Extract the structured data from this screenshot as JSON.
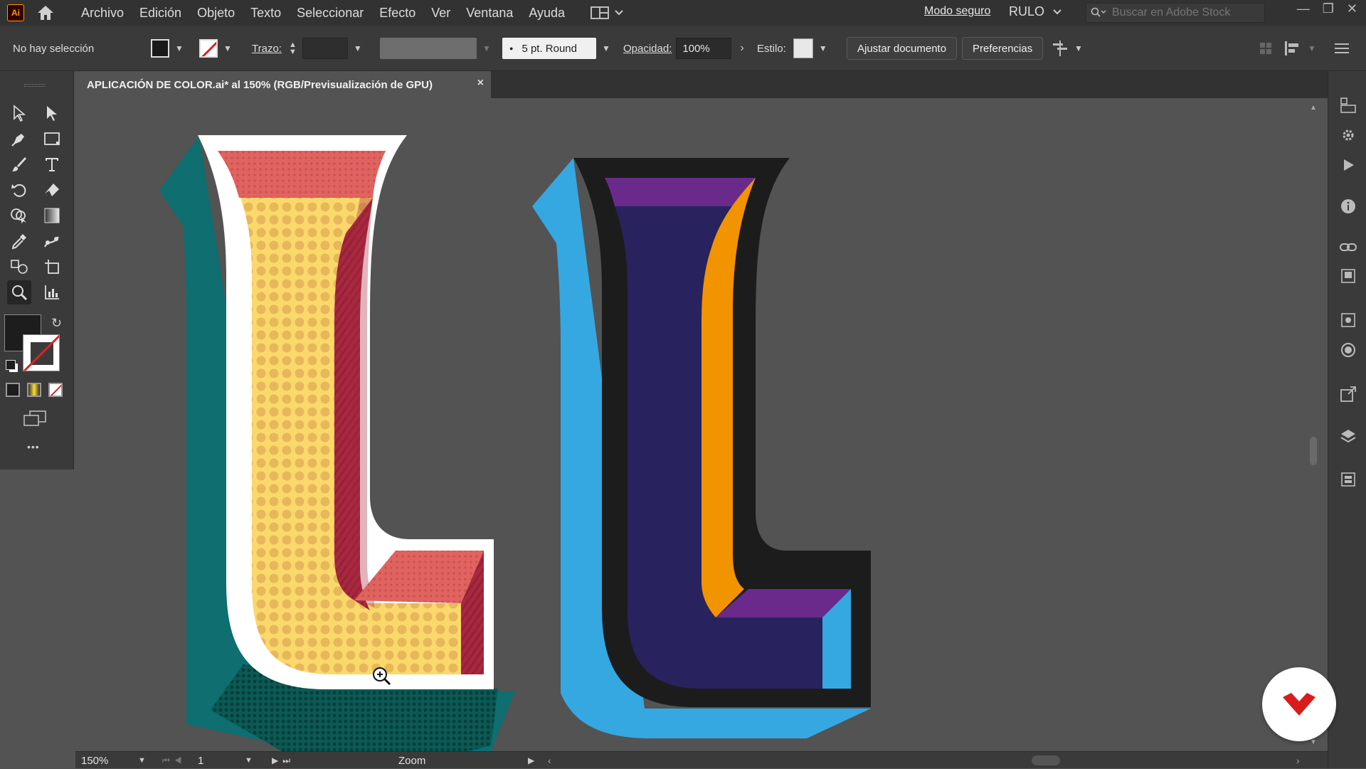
{
  "app": {
    "logo": "Ai",
    "menu": [
      "Archivo",
      "Edición",
      "Objeto",
      "Texto",
      "Seleccionar",
      "Efecto",
      "Ver",
      "Ventana",
      "Ayuda"
    ],
    "mode": "Modo seguro",
    "user": "RULO",
    "search_placeholder": "Buscar en Adobe Stock"
  },
  "control_bar": {
    "selection": "No hay selección",
    "stroke_label": "Trazo:",
    "brush": "5 pt. Round",
    "opacity_label": "Opacidad:",
    "opacity_value": "100%",
    "style_label": "Estilo:",
    "adjust_doc": "Ajustar documento",
    "preferences": "Preferencias"
  },
  "document": {
    "tab_title": "APLICACIÓN DE COLOR.ai* al 150% (RGB/Previsualización de GPU)",
    "close": "×"
  },
  "status": {
    "zoom": "150%",
    "page": "1",
    "tool_name": "Zoom"
  },
  "artwork_colors": {
    "teal": "#0e6e70",
    "coral": "#e0635f",
    "yellow": "#fbd86b",
    "crimson": "#a8283e",
    "sky": "#35a8e2",
    "navy": "#28225e",
    "purple": "#6a2a8c",
    "orange": "#f29300",
    "black": "#1c1c1c"
  },
  "toolbar": {
    "more": "•••"
  }
}
